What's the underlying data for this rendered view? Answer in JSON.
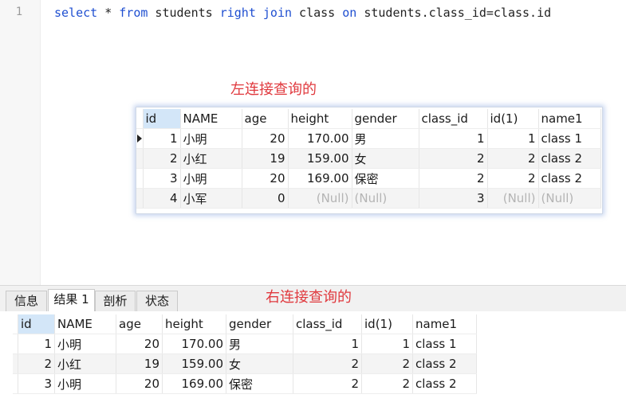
{
  "editor": {
    "line_number": "1",
    "sql": {
      "t1": "select",
      "t2": " * ",
      "t3": "from",
      "t4": " students ",
      "t5": "right",
      "t6": " ",
      "t7": "join",
      "t8": " class ",
      "t9": "on",
      "t10": " students.class_id=class.id"
    }
  },
  "annotations": {
    "left_join": "左连接查询的",
    "right_join": "右连接查询的"
  },
  "popup_grid": {
    "columns": [
      "id",
      "NAME",
      "age",
      "height",
      "gender",
      "class_id",
      "id(1)",
      "name1"
    ],
    "rows": [
      [
        "1",
        "小明",
        "20",
        "170.00",
        "男",
        "1",
        "1",
        "class 1"
      ],
      [
        "2",
        "小红",
        "19",
        "159.00",
        "女",
        "2",
        "2",
        "class 2"
      ],
      [
        "3",
        "小明",
        "20",
        "169.00",
        "保密",
        "2",
        "2",
        "class 2"
      ],
      [
        "4",
        "小军",
        "0",
        "(Null)",
        "(Null)",
        "3",
        "(Null)",
        "(Null)"
      ]
    ]
  },
  "tabs": [
    "信息",
    "结果 1",
    "剖析",
    "状态"
  ],
  "active_tab": "结果 1",
  "result_grid": {
    "columns": [
      "id",
      "NAME",
      "age",
      "height",
      "gender",
      "class_id",
      "id(1)",
      "name1"
    ],
    "rows": [
      [
        "1",
        "小明",
        "20",
        "170.00",
        "男",
        "1",
        "1",
        "class 1"
      ],
      [
        "2",
        "小红",
        "19",
        "159.00",
        "女",
        "2",
        "2",
        "class 2"
      ],
      [
        "3",
        "小明",
        "20",
        "169.00",
        "保密",
        "2",
        "2",
        "class 2"
      ]
    ]
  }
}
